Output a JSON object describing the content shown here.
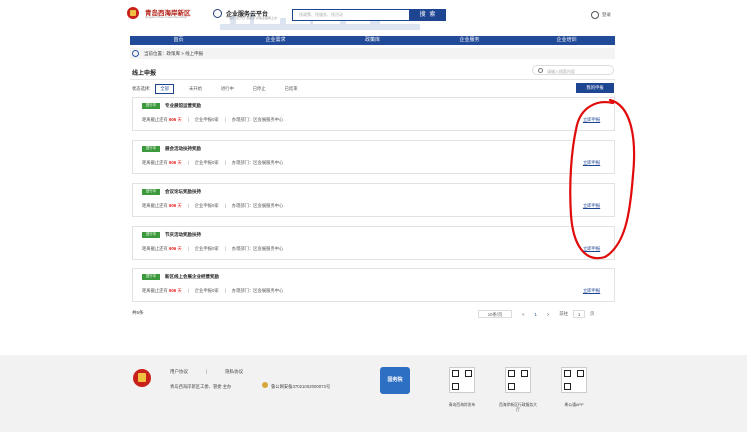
{
  "header": {
    "brand1": "青岛西海岸新区",
    "brand1_sub": "Qingdao West Coast New Area",
    "brand2": "企业服务云平台",
    "brand2_sub": "一站式·全方位·零距离·办事全程网上办",
    "search_placeholder": "找政策、找服务、找活动",
    "search_button": "搜 索",
    "login": "登录"
  },
  "nav": {
    "items": [
      "首页",
      "企业需求",
      "政策库",
      "企业服务",
      "企业培训"
    ]
  },
  "breadcrumb": "当前位置：政策库 > 线上申报",
  "page": {
    "title": "线上申报",
    "search_placeholder": "请输入搜索内容",
    "filter_label": "状态选择:",
    "filters": [
      "全部",
      "未开始",
      "进行中",
      "已停止",
      "已结束"
    ],
    "apply_button": "我的申报"
  },
  "cards": [
    {
      "tag": "进行中",
      "name": "专业展馆运营奖励",
      "days_label": "距离截止还有",
      "days": "606",
      "days_unit": "天",
      "apply_count": "企业申报0家",
      "dept": "办理部门：区会展服务中心",
      "button": "立即申报"
    },
    {
      "tag": "进行中",
      "name": "展会活动扶持奖励",
      "days_label": "距离截止还有",
      "days": "606",
      "days_unit": "天",
      "apply_count": "企业申报0家",
      "dept": "办理部门：区会展服务中心",
      "button": "立即申报"
    },
    {
      "tag": "进行中",
      "name": "会议论坛奖励扶持",
      "days_label": "距离截止还有",
      "days": "606",
      "days_unit": "天",
      "apply_count": "企业申报0家",
      "dept": "办理部门：区会展服务中心",
      "button": "立即申报"
    },
    {
      "tag": "进行中",
      "name": "节庆活动奖励扶持",
      "days_label": "距离截止还有",
      "days": "606",
      "days_unit": "天",
      "apply_count": "企业申报0家",
      "dept": "办理部门：区会展服务中心",
      "button": "立即申报"
    },
    {
      "tag": "进行中",
      "name": "新区线上会展企业经营奖励",
      "days_label": "距离截止还有",
      "days": "606",
      "days_unit": "天",
      "apply_count": "企业申报0家",
      "dept": "办理部门：区会展服务中心",
      "button": "立即申报"
    }
  ],
  "pagination": {
    "total": "共5条",
    "page_size": "10条/页",
    "prev": "<",
    "current": "1",
    "next": ">",
    "goto_label": "前往",
    "goto_value": "1",
    "goto_unit": "页"
  },
  "footer": {
    "link1": "用户协议",
    "link_sep": "|",
    "link2": "隐私协议",
    "host": "青岛西海岸新区工委、管委 主办",
    "beian": "鲁公网安备37021002000073号",
    "gov_label": "国务院",
    "qr_labels": [
      "青岛西海岸发布",
      "西海岸新区行政服务大厅",
      "希公通APP"
    ]
  },
  "colors": {
    "primary": "#1e4592",
    "nav": "#214a98",
    "accent_red": "#e21b1b",
    "tag_green": "#3c9a3c"
  }
}
